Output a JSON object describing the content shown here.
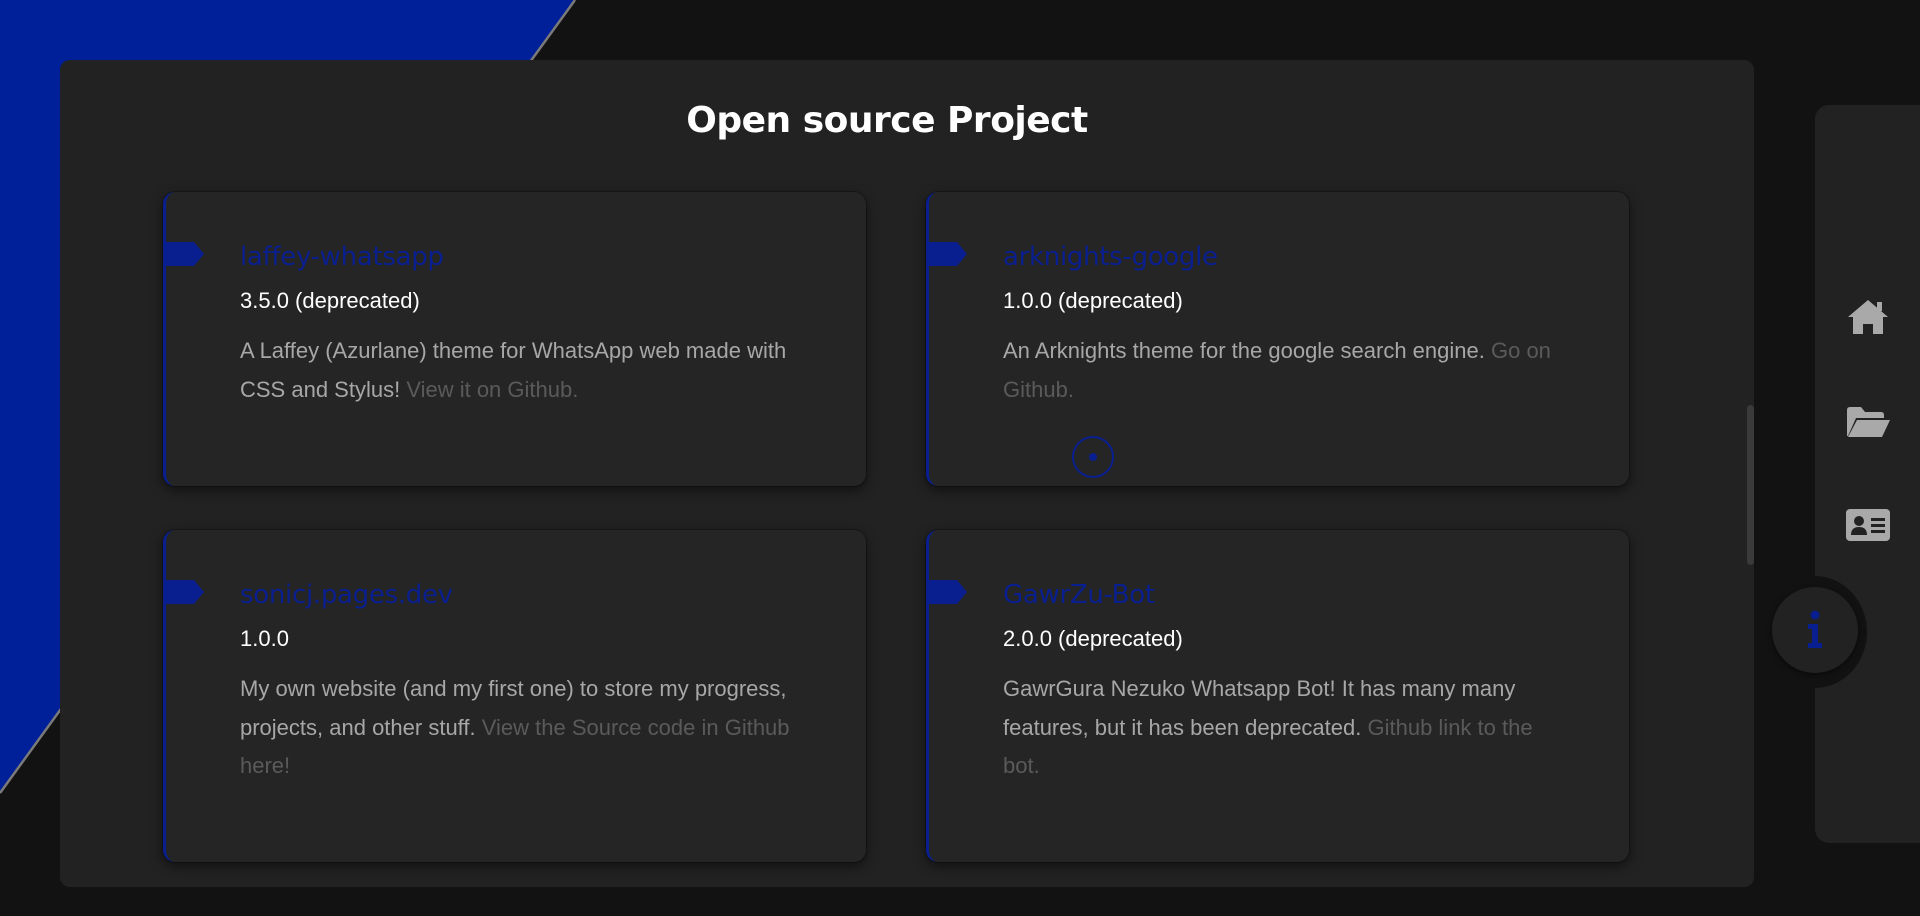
{
  "page": {
    "title": "Open source Project"
  },
  "colors": {
    "accent": "#0a1f8f",
    "background": "#121212",
    "panel": "#222222",
    "card": "#252525",
    "text_primary": "#ffffff",
    "text_secondary": "#a7a7a7",
    "text_link": "#5a5a5a"
  },
  "projects": [
    {
      "name": "laffey-whatsapp",
      "version": "3.5.0 (deprecated)",
      "description": "A Laffey (Azurlane) theme for WhatsApp web made with CSS and Stylus! ",
      "link_text": "View it on Github."
    },
    {
      "name": "arknights-google",
      "version": "1.0.0 (deprecated)",
      "description": "An Arknights theme for the google search engine. ",
      "link_text": "Go on Github."
    },
    {
      "name": "sonicj.pages.dev",
      "version": "1.0.0",
      "description": "My own website (and my first one) to store my progress, projects, and other stuff. ",
      "link_text": "View the Source code in Github here!"
    },
    {
      "name": "GawrZu-Bot",
      "version": "2.0.0 (deprecated)",
      "description": "GawrGura Nezuko Whatsapp Bot! It has many many features, but it has been deprecated. ",
      "link_text": "Github link to the bot."
    }
  ],
  "side_nav": {
    "items": [
      {
        "icon": "home-icon"
      },
      {
        "icon": "folder-open-icon"
      },
      {
        "icon": "contact-card-icon"
      }
    ],
    "info_button": {
      "icon": "info-icon"
    }
  }
}
